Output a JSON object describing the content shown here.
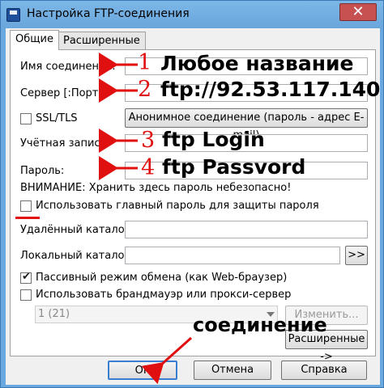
{
  "window": {
    "title": "Настройка FTP-соединения",
    "close_glyph": "✕"
  },
  "tabs": [
    {
      "label": "Общие",
      "active": true
    },
    {
      "label": "Расширенные",
      "active": false
    }
  ],
  "form": {
    "name_label": "Имя соединения:",
    "server_label": "Сервер [:Порт]:",
    "ssl_label": "SSL/TLS",
    "ssl_checked": false,
    "anon_button": "Анонимное соединение (пароль - адрес E-mail)",
    "account_label": "Учётная запись:",
    "password_label": "Пароль:",
    "warning": "ВНИМАНИЕ: Хранить здесь пароль небезопасно!",
    "master_password_label": "Использовать главный пароль для защиты пароля",
    "master_password_checked": false,
    "remote_dir_label": "Удалённый каталог:",
    "local_dir_label": "Локальный каталог:",
    "browse_button": ">>",
    "passive_label": "Пассивный режим обмена (как Web-браузер)",
    "passive_checked": true,
    "firewall_label": "Использовать брандмауэр или прокси-сервер",
    "firewall_checked": false,
    "firewall_select_value": "1 (21)",
    "change_button": "Изменить...",
    "advanced_button": "Расширенные ->"
  },
  "footer": {
    "ok": "OK",
    "cancel": "Отмена",
    "help": "Справка"
  },
  "annotations": {
    "n1": "1",
    "t1": "Любое название",
    "n2": "2",
    "t2": "ftp://92.53.117.140",
    "n3": "3",
    "t3": "ftp Login",
    "n4": "4",
    "t4": "ftp Passvord",
    "connect": "соединение"
  },
  "colors": {
    "annotation_red": "#e01010",
    "titlebar": "#6aa9df"
  }
}
